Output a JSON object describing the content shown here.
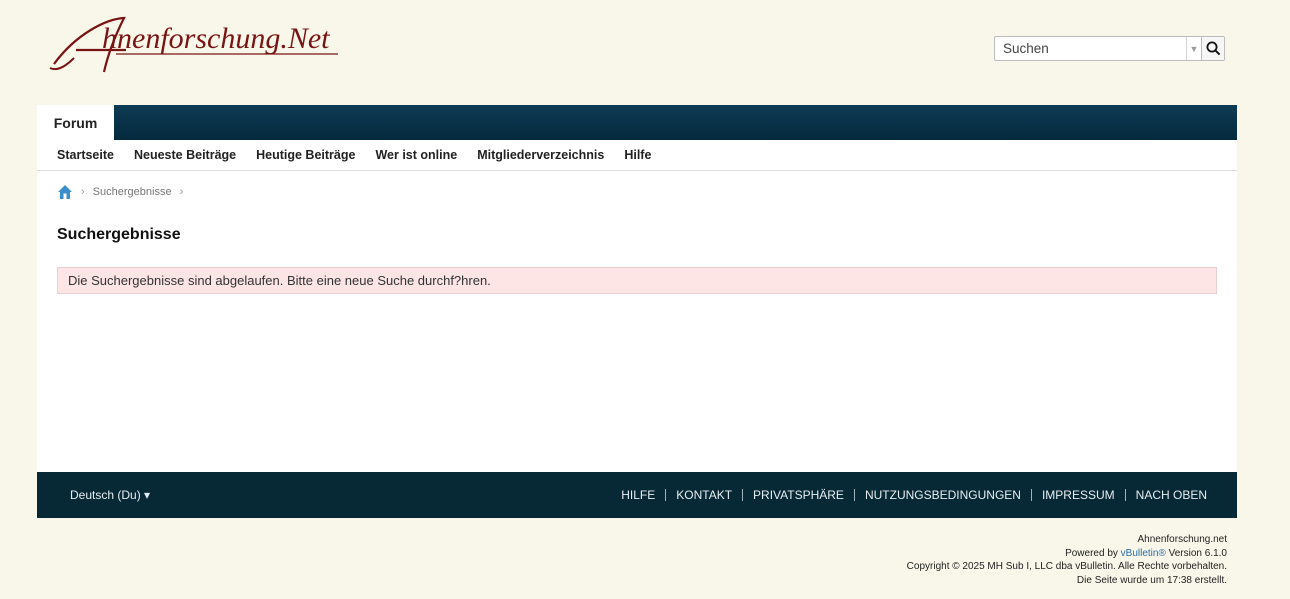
{
  "header": {
    "logo_text": "Ahnenforschung.Net",
    "search_placeholder": "Suchen"
  },
  "nav": {
    "main_tab": "Forum",
    "sub_items": [
      "Startseite",
      "Neueste Beiträge",
      "Heutige Beiträge",
      "Wer ist online",
      "Mitgliederverzeichnis",
      "Hilfe"
    ]
  },
  "breadcrumb": {
    "current": "Suchergebnisse"
  },
  "content": {
    "title": "Suchergebnisse",
    "alert": "Die Suchergebnisse sind abgelaufen. Bitte eine neue Suche durchf?hren."
  },
  "footer": {
    "language": "Deutsch (Du) ▾",
    "links": [
      "HILFE",
      "KONTAKT",
      "PRIVATSPHÄRE",
      "NUTZUNGSBEDINGUNGEN",
      "IMPRESSUM",
      "NACH OBEN"
    ]
  },
  "copyright": {
    "site": "Ahnenforschung.net",
    "powered_prefix": "Powered by ",
    "powered_link": "vBulletin®",
    "powered_suffix": " Version 6.1.0",
    "line3": "Copyright © 2025 MH Sub I, LLC dba vBulletin. Alle Rechte vorbehalten.",
    "line4": "Die Seite wurde um 17:38 erstellt."
  },
  "colors": {
    "background": "#f9f7e9",
    "nav_dark": "#072835",
    "logo": "#7a1414",
    "alert_bg": "#fde5e5"
  }
}
